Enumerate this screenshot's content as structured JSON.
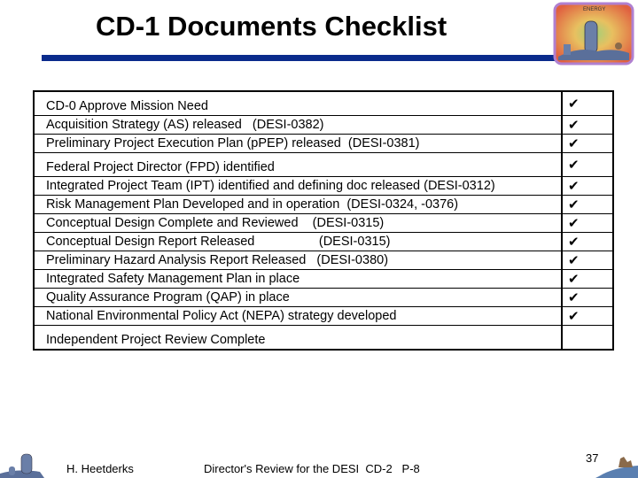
{
  "slide": {
    "title": "CD-1 Documents Checklist",
    "logo": "dark-energy-logo",
    "accent_color": "#0a2b8c"
  },
  "checklist": {
    "check_glyph": "✔",
    "items": [
      {
        "text": "CD-0 Approve Mission Need",
        "done": true
      },
      {
        "text": "Acquisition Strategy (AS) released   (DESI-0382)",
        "done": true
      },
      {
        "text": "Preliminary Project Execution Plan (pPEP) released  (DESI-0381)",
        "done": true
      },
      {
        "text": "Federal Project Director (FPD) identified",
        "done": true
      },
      {
        "text": "Integrated Project Team (IPT) identified and defining doc released (DESI-0312)",
        "done": true
      },
      {
        "text": "Risk Management Plan Developed and in operation  (DESI-0324, -0376)",
        "done": true
      },
      {
        "text": "Conceptual Design Complete and Reviewed    (DESI-0315)",
        "done": true
      },
      {
        "text": "Conceptual Design Report Released                  (DESI-0315)",
        "done": true
      },
      {
        "text": "Preliminary Hazard Analysis Report Released   (DESI-0380)",
        "done": true
      },
      {
        "text": "Integrated Safety Management Plan in place",
        "done": true
      },
      {
        "text": "Quality Assurance Program (QAP) in place",
        "done": true
      },
      {
        "text": "National Environmental Policy Act (NEPA) strategy developed",
        "done": true
      },
      {
        "text": "Independent Project Review Complete",
        "done": false
      }
    ]
  },
  "footer": {
    "author": "H. Heetderks",
    "event": "Director's Review for the DESI  CD-2   P-8",
    "page_number": "37"
  }
}
